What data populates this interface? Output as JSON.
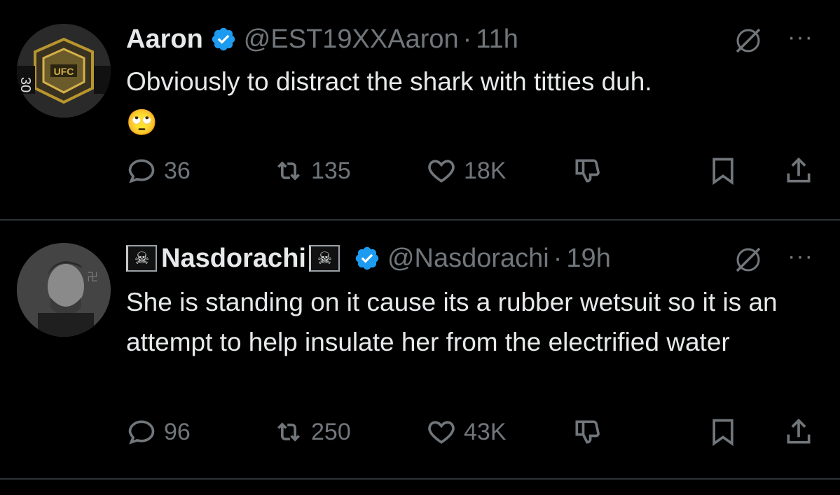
{
  "tweets": [
    {
      "name": "Aaron",
      "handle": "@EST19XXAaron",
      "separator": "·",
      "time": "11h",
      "text": "Obviously to distract the shark with titties duh.",
      "emoji": "🙄",
      "replies": "36",
      "reposts": "135",
      "likes": "18K",
      "more_label": "···"
    },
    {
      "name": "Nasdorachi",
      "name_prefix_flag": "☠",
      "name_suffix_flag": "☠",
      "handle": "@Nasdorachi",
      "separator": "·",
      "time": "19h",
      "text": "She is standing on it cause its a rubber wetsuit so it is an attempt to help insulate her from the electrified water",
      "replies": "96",
      "reposts": "250",
      "likes": "43K",
      "more_label": "···"
    }
  ],
  "icons": {
    "verified": "verified-badge-icon",
    "grok": "grok-icon",
    "reply": "reply-icon",
    "repost": "repost-icon",
    "like": "heart-icon",
    "dislike": "thumbs-down-icon",
    "bookmark": "bookmark-icon",
    "share": "share-icon"
  },
  "colors": {
    "background": "#000000",
    "text": "#e7e9ea",
    "muted": "#71767b",
    "verified": "#1d9bf0",
    "divider": "#2f3336"
  }
}
